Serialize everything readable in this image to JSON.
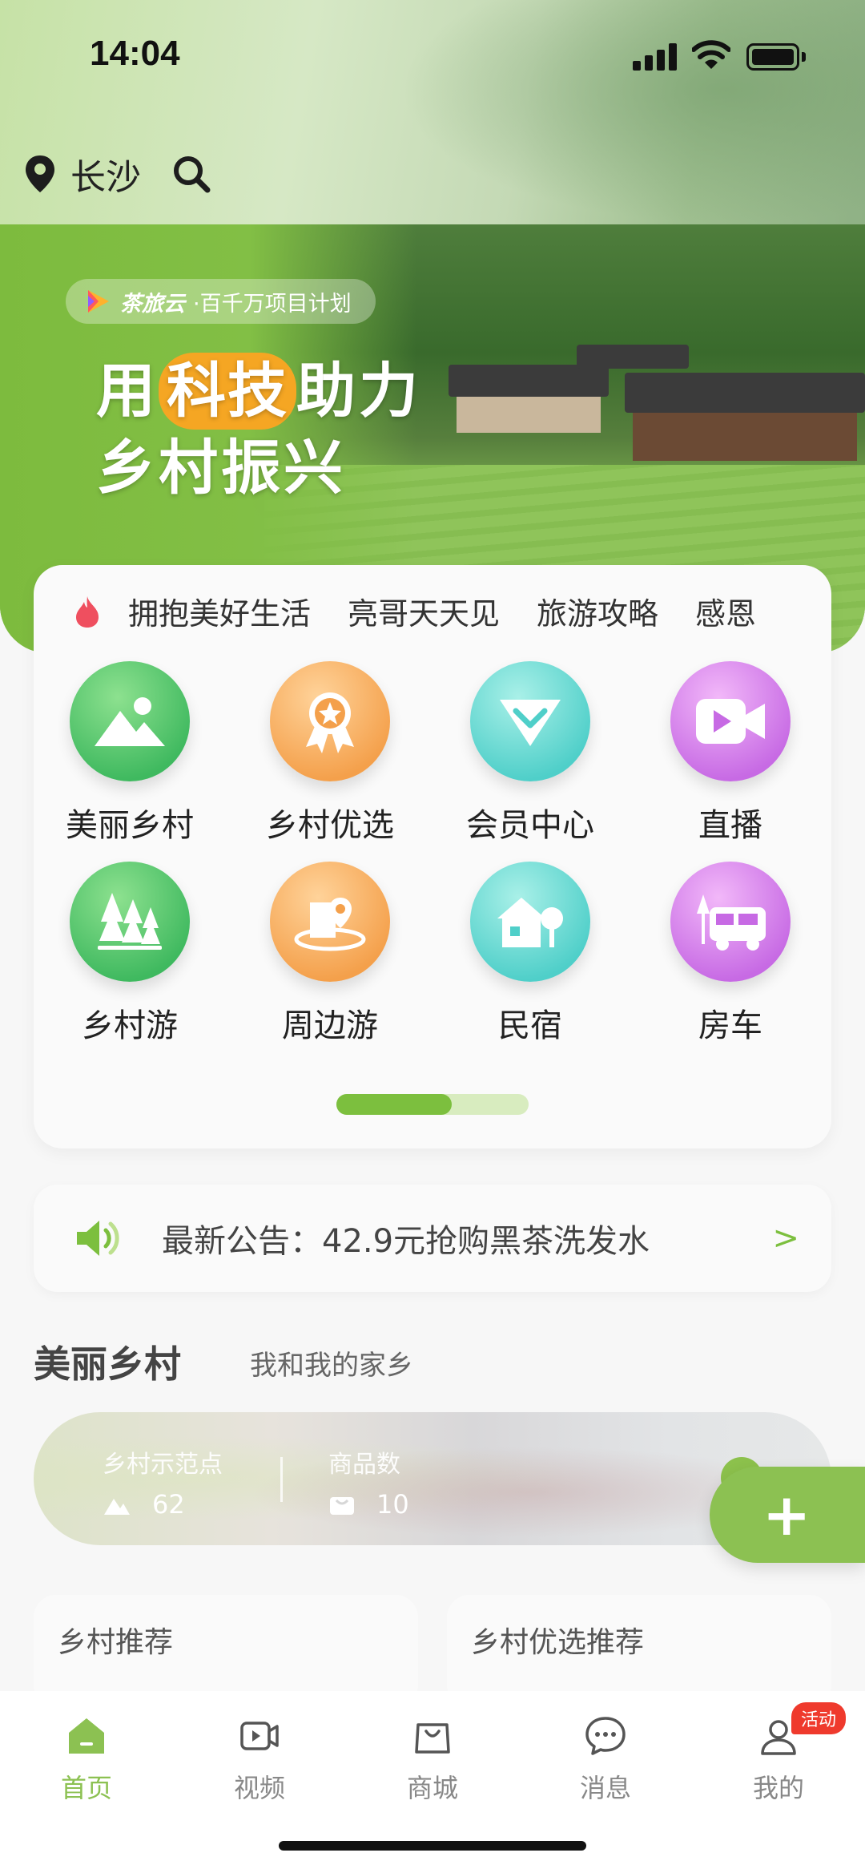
{
  "status": {
    "time": "14:04"
  },
  "location": {
    "city": "长沙"
  },
  "banner": {
    "brand": "茶旅云",
    "plan": "·百千万项目计划",
    "title_part1": "用",
    "title_highlight": "科技",
    "title_part2": "助力",
    "title_line2": "乡村振兴"
  },
  "hot_topics": [
    "拥抱美好生活",
    "亮哥天天见",
    "旅游攻略",
    "感恩"
  ],
  "categories": [
    {
      "label": "美丽乡村",
      "icon": "mountain-icon",
      "color": "green"
    },
    {
      "label": "乡村优选",
      "icon": "award-icon",
      "color": "orange"
    },
    {
      "label": "会员中心",
      "icon": "diamond-icon",
      "color": "teal"
    },
    {
      "label": "直播",
      "icon": "video-camera-icon",
      "color": "purple"
    },
    {
      "label": "乡村游",
      "icon": "forest-icon",
      "color": "green"
    },
    {
      "label": "周边游",
      "icon": "location-house-icon",
      "color": "orange"
    },
    {
      "label": "民宿",
      "icon": "house-tree-icon",
      "color": "teal"
    },
    {
      "label": "房车",
      "icon": "rv-icon",
      "color": "purple"
    }
  ],
  "pager": {
    "progress": 0.6
  },
  "notice": {
    "text": "最新公告：42.9元抢购黑茶洗发水",
    "arrow": ">"
  },
  "section": {
    "title": "美丽乡村",
    "subtitle": "我和我的家乡",
    "stats": [
      {
        "label": "乡村示范点",
        "value": "62",
        "icon": "mountain-small-icon"
      },
      {
        "label": "商品数",
        "value": "10",
        "icon": "bag-small-icon"
      }
    ]
  },
  "fab": {
    "label": "+"
  },
  "recommend": [
    {
      "title": "乡村推荐"
    },
    {
      "title": "乡村优选推荐"
    }
  ],
  "tabs": [
    {
      "label": "首页",
      "icon": "home-icon",
      "active": true
    },
    {
      "label": "视频",
      "icon": "video-icon",
      "active": false
    },
    {
      "label": "商城",
      "icon": "shopping-bag-icon",
      "active": false
    },
    {
      "label": "消息",
      "icon": "message-icon",
      "active": false
    },
    {
      "label": "我的",
      "icon": "profile-icon",
      "active": false,
      "badge": "活动"
    }
  ],
  "colors": {
    "accent": "#8cc152",
    "highlight": "#f5a623",
    "badge": "#ef3a2d"
  }
}
